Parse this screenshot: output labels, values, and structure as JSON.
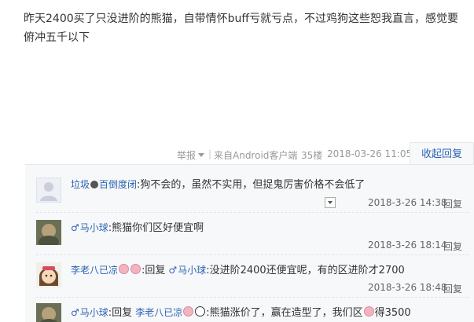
{
  "post": {
    "text": "昨天2400买了只没进阶的熊猫，自带情怀buff亏就亏点，不过鸡狗这些恕我直言，感觉要俯冲五千以下"
  },
  "post_meta": {
    "report_label": "举报",
    "separator": "|",
    "source": "来自Android客户端",
    "floor": "35楼",
    "time": "2018-03-26 11:05",
    "fold_reply_label": "收起回复"
  },
  "replies": [
    {
      "username": "垃圾",
      "username_suffix": "百倒度闭",
      "separator": ":",
      "content": "狗不会的，虽然不实用，但捉鬼厉害价格不会低了",
      "time": "2018-3-26 14:38",
      "reply_label": "回复"
    },
    {
      "gender_symbol": "♂",
      "username": "马小球",
      "separator": ":",
      "content": "熊猫你们区好便宜啊",
      "time": "2018-3-26 18:14",
      "reply_label": "回复"
    },
    {
      "username": "李老八已凉",
      "separator": ":",
      "reply_word": "回复",
      "target_gender": "♂",
      "target_username": "马小球",
      "target_separator": ":",
      "content": "没进阶2400还便宜呢，有的区进阶才2700",
      "time": "2018-3-26 18:48",
      "reply_label": "回复"
    },
    {
      "gender_symbol": "♂",
      "username": "马小球",
      "separator": ":",
      "reply_word": "回复",
      "target_username": "李老八已凉",
      "target_separator": ":",
      "content_a": "熊猫涨价了，赢在造型了，我们区",
      "content_b": "得3500"
    }
  ],
  "colors": {
    "link_blue": "#2d64b3",
    "text": "#333333",
    "meta_gray": "#999999",
    "reply_bg": "#f7f8fa"
  }
}
